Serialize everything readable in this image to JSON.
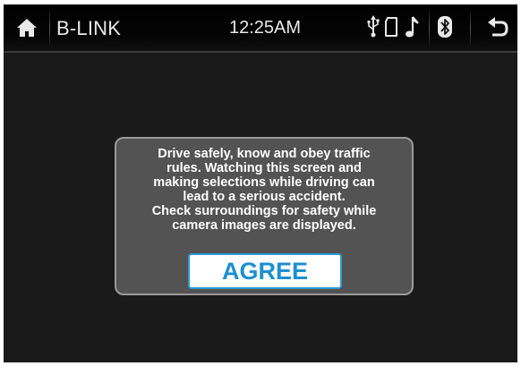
{
  "statusbar": {
    "title": "B-LINK",
    "time": "12:25AM",
    "icons": [
      "home-icon",
      "usb-icon",
      "sd-card-icon",
      "music-note-icon",
      "bluetooth-icon",
      "back-icon"
    ]
  },
  "dialog": {
    "message_lines": [
      "Drive safely, know and obey traffic",
      "rules. Watching this screen and",
      "making selections while driving can",
      "lead to a serious accident.",
      "Check surroundings for safety while",
      "camera images are displayed."
    ],
    "agree_label": "AGREE"
  },
  "colors": {
    "background": "#171717",
    "dialog_bg": "#535353",
    "accent": "#1d8fd0"
  }
}
